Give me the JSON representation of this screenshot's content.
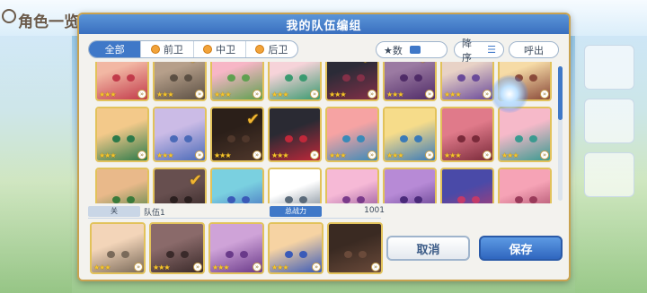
{
  "background": {
    "title": "角色一览"
  },
  "modal": {
    "title": "我的队伍编组"
  },
  "filters": {
    "tabs": [
      {
        "label": "全部",
        "active": true
      },
      {
        "label": "前卫",
        "active": false
      },
      {
        "label": "中卫",
        "active": false
      },
      {
        "label": "后卫",
        "active": false
      }
    ],
    "stars_label": "★数",
    "sort_label": "降序",
    "exit_label": "呼出"
  },
  "roster": {
    "rows": [
      [
        {
          "colors": [
            "#f2b7a3",
            "#c23a4a"
          ],
          "stars": "★★★",
          "selected": false
        },
        {
          "colors": [
            "#f3d5b9",
            "#7a6a5a"
          ],
          "stars": "★★★",
          "selected": true
        },
        {
          "colors": [
            "#f7b6c6",
            "#5fa050"
          ],
          "stars": "★★★",
          "selected": false
        },
        {
          "colors": [
            "#f6d3d9",
            "#3a9a70"
          ],
          "stars": "★★★",
          "selected": false
        },
        {
          "colors": [
            "#3a3a4a",
            "#b04060"
          ],
          "stars": "★★★",
          "selected": true
        },
        {
          "colors": [
            "#cfa3d8",
            "#6a3a8a"
          ],
          "stars": "★★★",
          "selected": true
        },
        {
          "colors": [
            "#e8d2c6",
            "#6a4a9a"
          ],
          "stars": "★★★",
          "selected": false
        },
        {
          "colors": [
            "#f6dba6",
            "#8a4a3a"
          ],
          "stars": "★★★",
          "selected": false
        }
      ],
      [
        {
          "colors": [
            "#f3c98a",
            "#2c7a4a"
          ],
          "stars": "★★★",
          "selected": false
        },
        {
          "colors": [
            "#cbbbe6",
            "#4a6ab8"
          ],
          "stars": "★★★",
          "selected": false
        },
        {
          "colors": [
            "#3a2a22",
            "#6a4a3a"
          ],
          "stars": "★★★",
          "selected": true
        },
        {
          "colors": [
            "#2a2a33",
            "#c0283a"
          ],
          "stars": "★★★",
          "selected": false
        },
        {
          "colors": [
            "#f6a3a3",
            "#3a8ab8"
          ],
          "stars": "★★★",
          "selected": false
        },
        {
          "colors": [
            "#f6dc8a",
            "#3a7ab8"
          ],
          "stars": "★★★",
          "selected": false
        },
        {
          "colors": [
            "#e07a8a",
            "#7a2a3a"
          ],
          "stars": "★★★",
          "selected": false
        },
        {
          "colors": [
            "#f6b9c9",
            "#3a9a90"
          ],
          "stars": "★★★",
          "selected": false
        }
      ],
      [
        {
          "colors": [
            "#e9b98a",
            "#3a7a3a"
          ],
          "stars": "★★★",
          "selected": false
        },
        {
          "colors": [
            "#8a6a6a",
            "#3a2a2a"
          ],
          "stars": "★★★",
          "selected": true
        },
        {
          "colors": [
            "#7ad0e0",
            "#3a5ab8"
          ],
          "stars": "★★★",
          "selected": false
        },
        {
          "colors": [
            "#ffffff",
            "#5a6a7a"
          ],
          "stars": "★★★",
          "selected": false
        },
        {
          "colors": [
            "#f6b9d6",
            "#7a3a8a"
          ],
          "stars": "★★★",
          "selected": false
        },
        {
          "colors": [
            "#b78ad6",
            "#4a2a7a"
          ],
          "stars": "★★★",
          "selected": false
        },
        {
          "colors": [
            "#4a4aa8",
            "#c23a6a"
          ],
          "stars": "★★★",
          "selected": false
        },
        {
          "colors": [
            "#f6a3b6",
            "#9a3a5a"
          ],
          "stars": "★★★",
          "selected": false
        }
      ]
    ]
  },
  "party": {
    "tag_label": "关",
    "name": "队伍1",
    "power_label": "总战力",
    "power_value": "1001",
    "members": [
      {
        "colors": [
          "#f3d5b9",
          "#7a6a5a"
        ],
        "stars": "★★★"
      },
      {
        "colors": [
          "#8a6a6a",
          "#3a2a2a"
        ],
        "stars": "★★★"
      },
      {
        "colors": [
          "#cfa3d8",
          "#6a3a8a"
        ],
        "stars": "★★★"
      },
      {
        "colors": [
          "#f6d3a3",
          "#3a5ab8"
        ],
        "stars": "★★★"
      },
      {
        "colors": [
          "#3a2a22",
          "#6a4a3a"
        ],
        "stars": ""
      }
    ]
  },
  "buttons": {
    "cancel": "取消",
    "save": "保存"
  },
  "accent": {
    "blue": "#3f78c8",
    "gold": "#e2c25a"
  }
}
